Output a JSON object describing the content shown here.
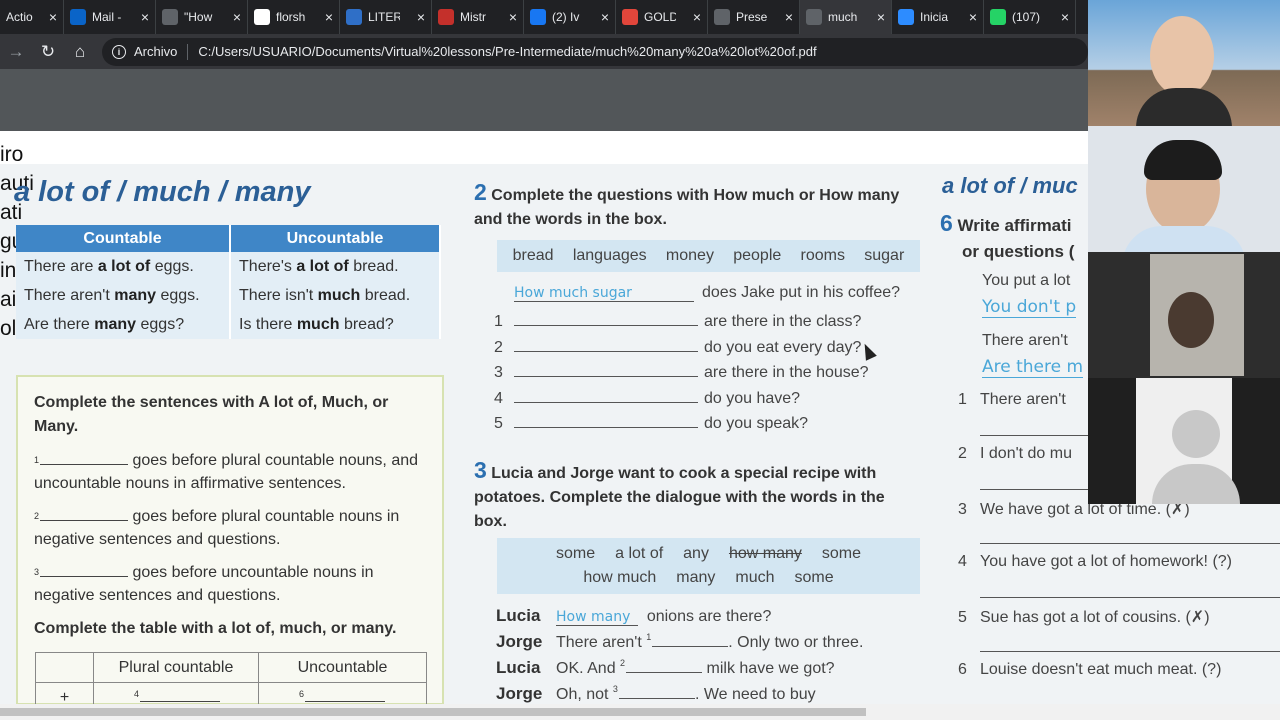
{
  "browser": {
    "tabs": [
      {
        "title": "Actio",
        "favicon": "tab-icon",
        "color": "#5f6368",
        "active": false
      },
      {
        "title": "Mail -",
        "favicon": "outlook-icon",
        "color": "#0a64c8",
        "active": false
      },
      {
        "title": "\"How",
        "favicon": "globe-icon",
        "color": "#5f6368",
        "active": false
      },
      {
        "title": "florsh",
        "favicon": "google-icon",
        "color": "#ffffff",
        "active": false
      },
      {
        "title": "LITER",
        "favicon": "slides-icon",
        "color": "#2f6fc7",
        "active": false
      },
      {
        "title": "Mistr",
        "favicon": "red-circle-icon",
        "color": "#c4302b",
        "active": false
      },
      {
        "title": "(2) Iv",
        "favicon": "facebook-icon",
        "color": "#1877f2",
        "active": false
      },
      {
        "title": "GOLD",
        "favicon": "pdf-icon",
        "color": "#e2463b",
        "active": false
      },
      {
        "title": "Prese",
        "favicon": "globe-icon",
        "color": "#5f6368",
        "active": false
      },
      {
        "title": "much",
        "favicon": "globe-icon",
        "color": "#5f6368",
        "active": true
      },
      {
        "title": "Inicia",
        "favicon": "zoom-icon",
        "color": "#2d8cff",
        "active": false
      },
      {
        "title": "(107)",
        "favicon": "whatsapp-icon",
        "color": "#25d366",
        "active": false
      }
    ],
    "scheme": "Archivo",
    "url": "C:/Users/USUARIO/Documents/Virtual%20lessons/Pre-Intermediate/much%20many%20a%20lot%20of.pdf"
  },
  "left_cut": [
    "iro",
    "auti",
    "ati",
    "gus",
    "ina",
    "ai",
    "ola"
  ],
  "grammar": {
    "title": "a lot of  /  much  /  many",
    "headers": [
      "Countable",
      "Uncountable"
    ],
    "rows": [
      {
        "c_pre": "There are ",
        "c_b": "a lot of",
        "c_post": " eggs.",
        "u_pre": "There's ",
        "u_b": "a lot of",
        "u_post": " bread."
      },
      {
        "c_pre": "There aren't ",
        "c_b": "many",
        "c_post": " eggs.",
        "u_pre": "There isn't ",
        "u_b": "much",
        "u_post": " bread."
      },
      {
        "c_pre": "Are there ",
        "c_b": "many",
        "c_post": " eggs?",
        "u_pre": "Is there ",
        "u_b": "much",
        "u_post": " bread?"
      }
    ]
  },
  "box1": {
    "instruction": "Complete the sentences with A lot of, Much, or Many.",
    "rules": [
      {
        "num": "1",
        "text": " goes before plural countable nouns, and uncountable nouns in affirmative sentences."
      },
      {
        "num": "2",
        "text": " goes before plural countable nouns in negative sentences and questions."
      },
      {
        "num": "3",
        "text": " goes before uncountable nouns in negative sentences and questions."
      }
    ],
    "table_instruction": "Complete the table with a lot of, much, or many.",
    "table_headers": [
      "Plural countable",
      "Uncountable"
    ],
    "table_row": {
      "sign": "+",
      "c_num": "4",
      "u_num": "6"
    }
  },
  "section2": {
    "number": "2",
    "heading": "Complete the questions with How much or How many and the words in the box.",
    "words": [
      "bread",
      "languages",
      "money",
      "people",
      "rooms",
      "sugar"
    ],
    "example": {
      "answer": "How much sugar",
      "rest": "does Jake put in his coffee?"
    },
    "questions": [
      {
        "num": "1",
        "rest": "are there in the class?"
      },
      {
        "num": "2",
        "rest": "do you eat every day?"
      },
      {
        "num": "3",
        "rest": "are there in the house?"
      },
      {
        "num": "4",
        "rest": "do you have?"
      },
      {
        "num": "5",
        "rest": "do you speak?"
      }
    ]
  },
  "section3": {
    "number": "3",
    "heading": "Lucia and Jorge want to cook a special recipe with potatoes. Complete the dialogue with the words in the box.",
    "words_row1": [
      "some",
      "a lot of",
      "any",
      "how many",
      "some"
    ],
    "words_row2": [
      "how much",
      "many",
      "much",
      "some"
    ],
    "dialogue": [
      {
        "speaker": "Lucia",
        "answer": "How many",
        "text": " onions are there?"
      },
      {
        "speaker": "Jorge",
        "pre": "There aren't ",
        "num": "1",
        "post": ". Only two or three."
      },
      {
        "speaker": "Lucia",
        "pre": "OK. And ",
        "num": "2",
        "post": " milk have we got?"
      },
      {
        "speaker": "Jorge",
        "pre": "Oh, not ",
        "num": "3",
        "post": ". We need to buy"
      }
    ]
  },
  "section6": {
    "title": "a lot of / muc",
    "number": "6",
    "heading_l1": "Write affirmati",
    "heading_l2": "or questions (",
    "ex1": "You put a lot",
    "ex1_ans": "You don't p",
    "ex2": "There aren't",
    "ex2_ans": "Are there m",
    "items": [
      {
        "num": "1",
        "text": "There aren't"
      },
      {
        "num": "2",
        "text": "I don't do mu"
      },
      {
        "num": "3",
        "text": "We have got a lot of time. (✗)"
      },
      {
        "num": "4",
        "text": "You have got a lot of homework! (?)"
      },
      {
        "num": "5",
        "text": "Sue has got a lot of cousins. (✗)"
      },
      {
        "num": "6",
        "text": "Louise doesn't eat much meat. (?)"
      }
    ]
  }
}
